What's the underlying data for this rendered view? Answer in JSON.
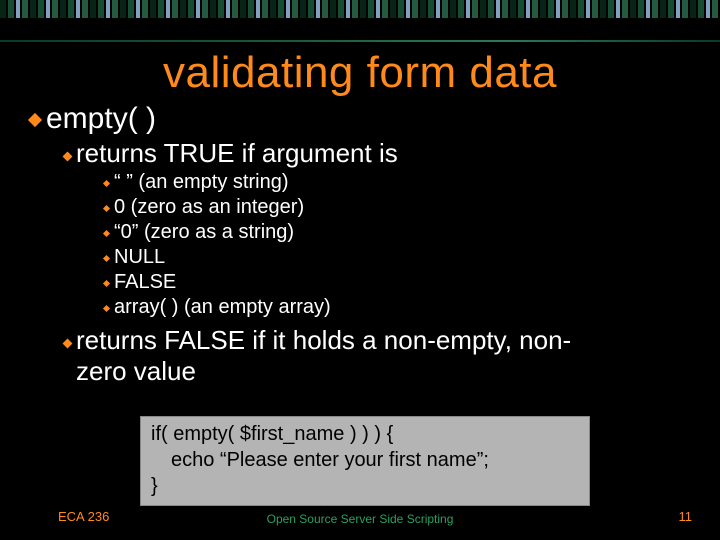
{
  "title": "validating form data",
  "lvl1": "empty( )",
  "lvl2_a": "returns TRUE if argument is",
  "items": [
    "“ ” (an empty string)",
    "0 (zero as an integer)",
    "“0” (zero as a string)",
    "NULL",
    "FALSE",
    "array( )  (an empty array)"
  ],
  "lvl2_b_line1": "returns FALSE if it holds a non-empty, non-",
  "lvl2_b_line2": "zero value",
  "code": {
    "l1": "if( empty( $first_name ) ) ) {",
    "l2": "echo “Please enter your first name”;",
    "l3": "}"
  },
  "footer": {
    "left": "ECA 236",
    "center": "Open Source Server Side Scripting",
    "right": "11"
  }
}
